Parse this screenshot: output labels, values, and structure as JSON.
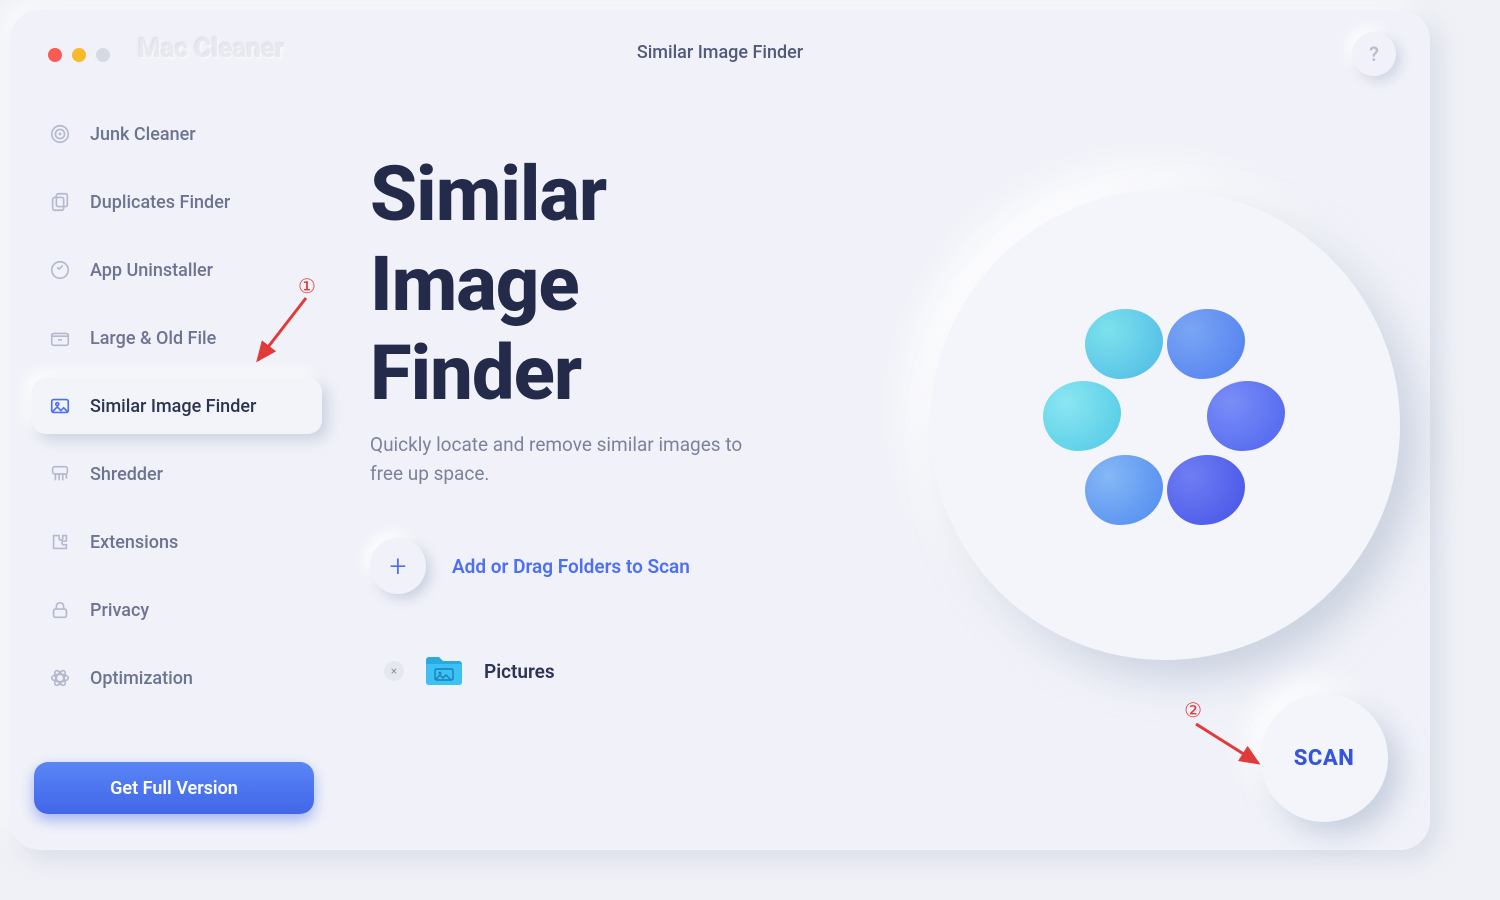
{
  "app_title": "Mac Cleaner",
  "page_title": "Similar Image Finder",
  "help_label": "?",
  "sidebar": {
    "items": [
      {
        "label": "Junk Cleaner"
      },
      {
        "label": "Duplicates Finder"
      },
      {
        "label": "App Uninstaller"
      },
      {
        "label": "Large & Old File"
      },
      {
        "label": "Similar Image Finder"
      },
      {
        "label": "Shredder"
      },
      {
        "label": "Extensions"
      },
      {
        "label": "Privacy"
      },
      {
        "label": "Optimization"
      }
    ],
    "active_index": 4
  },
  "full_version_label": "Get Full Version",
  "hero": {
    "title_line1": "Similar",
    "title_line2": "Image",
    "title_line3": "Finder",
    "description": "Quickly locate and remove similar images to free up space."
  },
  "add_folders": {
    "plus": "+",
    "label": "Add or Drag Folders to Scan"
  },
  "selected_folder": {
    "remove": "×",
    "name": "Pictures"
  },
  "scan_label": "SCAN",
  "annotations": {
    "one": "①",
    "two": "②"
  }
}
